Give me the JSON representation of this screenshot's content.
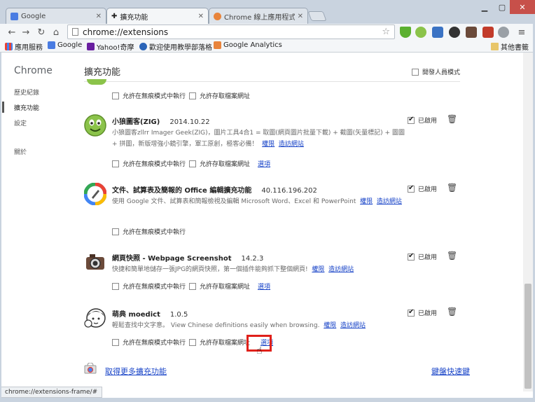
{
  "tabs": [
    {
      "label": "Google",
      "active": false
    },
    {
      "label": "擴充功能",
      "active": true
    },
    {
      "label": "Chrome 線上應用程式商店",
      "active": false
    }
  ],
  "omnibox": {
    "url": "chrome://extensions"
  },
  "bookmarks": [
    {
      "label": "應用服務"
    },
    {
      "label": "Google"
    },
    {
      "label": "Yahoo!奇摩"
    },
    {
      "label": "歡迎使用教學部落格"
    },
    {
      "label": "Google Analytics"
    },
    {
      "label": "其他書籤"
    }
  ],
  "sidebar": {
    "title": "Chrome",
    "items": [
      {
        "label": "歷史紀錄"
      },
      {
        "label": "擴充功能"
      },
      {
        "label": "設定"
      },
      {
        "label": "關於"
      }
    ]
  },
  "main": {
    "title": "擴充功能",
    "developer_mode_label": "開發人員模式"
  },
  "extensions": [
    {
      "name": "",
      "version": "",
      "opt_incognito": "允許在無痕模式中執行",
      "opt_file_urls": "允許存取檔案網址"
    },
    {
      "name": "小狼圖客(ZIG)",
      "version": "2014.10.22",
      "description": "小狼圖客zllrr Imager Geek(ZIG)，圖片工具4合1 = 取圖(網頁圖片批量下載) + 截圖(矢量標記) + 圖圖 + 拼圖，新版增強小鏡引擎，軍工原創，極客必備！",
      "permissions_link": "權限",
      "website_link": "造訪網站",
      "opt_incognito": "允許在無痕模式中執行",
      "opt_file_urls": "允許存取檔案網址",
      "options_link": "選項",
      "enabled_label": "已啟用"
    },
    {
      "name": "文件、試算表及簡報的 Office 編輯擴充功能",
      "version": "40.116.196.202",
      "description": "使用 Google 文件、試算表和簡報檢視及編輯 Microsoft Word、Excel 和 PowerPoint",
      "permissions_link": "權限",
      "website_link": "造訪網站",
      "opt_incognito": "允許在無痕模式中執行",
      "enabled_label": "已啟用"
    },
    {
      "name": "網頁快照 - Webpage Screenshot",
      "version": "14.2.3",
      "description": "快捷和簡單地儲存一張JPG的網頁快照，第一個插件能夠抓下整個網頁!",
      "permissions_link": "權限",
      "website_link": "造訪網站",
      "opt_incognito": "允許在無痕模式中執行",
      "opt_file_urls": "允許存取檔案網址",
      "options_link": "選項",
      "enabled_label": "已啟用"
    },
    {
      "name": "萌典 moedict",
      "version": "1.0.5",
      "description": "輕鬆查找中文字意。 View Chinese definitions easily when browsing.",
      "permissions_link": "權限",
      "website_link": "造訪網站",
      "opt_incognito": "允許在無痕模式中執行",
      "opt_file_urls": "允許存取檔案網址",
      "options_link": "選項",
      "enabled_label": "已啟用"
    }
  ],
  "footer": {
    "more_extensions": "取得更多擴充功能",
    "keyboard_shortcuts": "鍵盤快速鍵"
  },
  "status_bar": {
    "text": "chrome://extensions-frame/#"
  },
  "colors": {
    "link": "#1a45c8",
    "highlight": "#e0201a",
    "frame": "#c9d3df"
  }
}
